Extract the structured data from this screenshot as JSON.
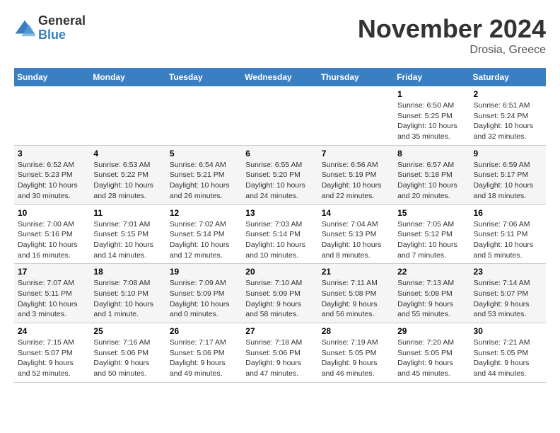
{
  "logo": {
    "general": "General",
    "blue": "Blue"
  },
  "header": {
    "month": "November 2024",
    "location": "Drosia, Greece"
  },
  "weekdays": [
    "Sunday",
    "Monday",
    "Tuesday",
    "Wednesday",
    "Thursday",
    "Friday",
    "Saturday"
  ],
  "weeks": [
    [
      {
        "day": "",
        "info": ""
      },
      {
        "day": "",
        "info": ""
      },
      {
        "day": "",
        "info": ""
      },
      {
        "day": "",
        "info": ""
      },
      {
        "day": "",
        "info": ""
      },
      {
        "day": "1",
        "info": "Sunrise: 6:50 AM\nSunset: 5:25 PM\nDaylight: 10 hours and 35 minutes."
      },
      {
        "day": "2",
        "info": "Sunrise: 6:51 AM\nSunset: 5:24 PM\nDaylight: 10 hours and 32 minutes."
      }
    ],
    [
      {
        "day": "3",
        "info": "Sunrise: 6:52 AM\nSunset: 5:23 PM\nDaylight: 10 hours and 30 minutes."
      },
      {
        "day": "4",
        "info": "Sunrise: 6:53 AM\nSunset: 5:22 PM\nDaylight: 10 hours and 28 minutes."
      },
      {
        "day": "5",
        "info": "Sunrise: 6:54 AM\nSunset: 5:21 PM\nDaylight: 10 hours and 26 minutes."
      },
      {
        "day": "6",
        "info": "Sunrise: 6:55 AM\nSunset: 5:20 PM\nDaylight: 10 hours and 24 minutes."
      },
      {
        "day": "7",
        "info": "Sunrise: 6:56 AM\nSunset: 5:19 PM\nDaylight: 10 hours and 22 minutes."
      },
      {
        "day": "8",
        "info": "Sunrise: 6:57 AM\nSunset: 5:18 PM\nDaylight: 10 hours and 20 minutes."
      },
      {
        "day": "9",
        "info": "Sunrise: 6:59 AM\nSunset: 5:17 PM\nDaylight: 10 hours and 18 minutes."
      }
    ],
    [
      {
        "day": "10",
        "info": "Sunrise: 7:00 AM\nSunset: 5:16 PM\nDaylight: 10 hours and 16 minutes."
      },
      {
        "day": "11",
        "info": "Sunrise: 7:01 AM\nSunset: 5:15 PM\nDaylight: 10 hours and 14 minutes."
      },
      {
        "day": "12",
        "info": "Sunrise: 7:02 AM\nSunset: 5:14 PM\nDaylight: 10 hours and 12 minutes."
      },
      {
        "day": "13",
        "info": "Sunrise: 7:03 AM\nSunset: 5:14 PM\nDaylight: 10 hours and 10 minutes."
      },
      {
        "day": "14",
        "info": "Sunrise: 7:04 AM\nSunset: 5:13 PM\nDaylight: 10 hours and 8 minutes."
      },
      {
        "day": "15",
        "info": "Sunrise: 7:05 AM\nSunset: 5:12 PM\nDaylight: 10 hours and 7 minutes."
      },
      {
        "day": "16",
        "info": "Sunrise: 7:06 AM\nSunset: 5:11 PM\nDaylight: 10 hours and 5 minutes."
      }
    ],
    [
      {
        "day": "17",
        "info": "Sunrise: 7:07 AM\nSunset: 5:11 PM\nDaylight: 10 hours and 3 minutes."
      },
      {
        "day": "18",
        "info": "Sunrise: 7:08 AM\nSunset: 5:10 PM\nDaylight: 10 hours and 1 minute."
      },
      {
        "day": "19",
        "info": "Sunrise: 7:09 AM\nSunset: 5:09 PM\nDaylight: 10 hours and 0 minutes."
      },
      {
        "day": "20",
        "info": "Sunrise: 7:10 AM\nSunset: 5:09 PM\nDaylight: 9 hours and 58 minutes."
      },
      {
        "day": "21",
        "info": "Sunrise: 7:11 AM\nSunset: 5:08 PM\nDaylight: 9 hours and 56 minutes."
      },
      {
        "day": "22",
        "info": "Sunrise: 7:13 AM\nSunset: 5:08 PM\nDaylight: 9 hours and 55 minutes."
      },
      {
        "day": "23",
        "info": "Sunrise: 7:14 AM\nSunset: 5:07 PM\nDaylight: 9 hours and 53 minutes."
      }
    ],
    [
      {
        "day": "24",
        "info": "Sunrise: 7:15 AM\nSunset: 5:07 PM\nDaylight: 9 hours and 52 minutes."
      },
      {
        "day": "25",
        "info": "Sunrise: 7:16 AM\nSunset: 5:06 PM\nDaylight: 9 hours and 50 minutes."
      },
      {
        "day": "26",
        "info": "Sunrise: 7:17 AM\nSunset: 5:06 PM\nDaylight: 9 hours and 49 minutes."
      },
      {
        "day": "27",
        "info": "Sunrise: 7:18 AM\nSunset: 5:06 PM\nDaylight: 9 hours and 47 minutes."
      },
      {
        "day": "28",
        "info": "Sunrise: 7:19 AM\nSunset: 5:05 PM\nDaylight: 9 hours and 46 minutes."
      },
      {
        "day": "29",
        "info": "Sunrise: 7:20 AM\nSunset: 5:05 PM\nDaylight: 9 hours and 45 minutes."
      },
      {
        "day": "30",
        "info": "Sunrise: 7:21 AM\nSunset: 5:05 PM\nDaylight: 9 hours and 44 minutes."
      }
    ]
  ]
}
